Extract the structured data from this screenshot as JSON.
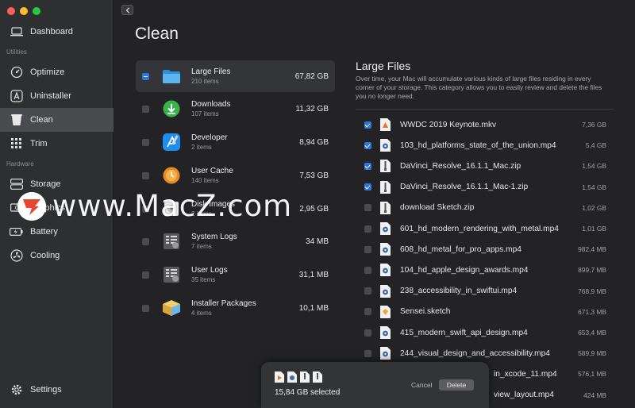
{
  "sidebar": {
    "items": [
      {
        "label": "Dashboard"
      },
      {
        "label": "Optimize"
      },
      {
        "label": "Uninstaller"
      },
      {
        "label": "Clean"
      },
      {
        "label": "Trim"
      },
      {
        "label": "Storage"
      },
      {
        "label": "Graphics"
      },
      {
        "label": "Battery"
      },
      {
        "label": "Cooling"
      },
      {
        "label": "Settings"
      }
    ],
    "sections": {
      "utilities": "Utilities",
      "hardware": "Hardware"
    }
  },
  "main": {
    "title": "Clean",
    "categories": [
      {
        "name": "Large Files",
        "count": "210 items",
        "size": "67,82 GB"
      },
      {
        "name": "Downloads",
        "count": "107 items",
        "size": "11,32 GB"
      },
      {
        "name": "Developer",
        "count": "2 items",
        "size": "8,94 GB"
      },
      {
        "name": "User Cache",
        "count": "140 items",
        "size": "7,53 GB"
      },
      {
        "name": "Disk Images",
        "count": "2 items",
        "size": "2,95 GB"
      },
      {
        "name": "System Logs",
        "count": "7 items",
        "size": "34 MB"
      },
      {
        "name": "User Logs",
        "count": "35 items",
        "size": "31,1 MB"
      },
      {
        "name": "Installer Packages",
        "count": "4 items",
        "size": "10,1 MB"
      }
    ]
  },
  "panel": {
    "title": "Large Files",
    "description": "Over time, your Mac will accumulate various kinds of large files residing in every corner of your storage. This category allows you to easily review and delete the files you no longer need.",
    "files": [
      {
        "name": "WWDC 2019 Keynote.mkv",
        "size": "7,36 GB"
      },
      {
        "name": "103_hd_platforms_state_of_the_union.mp4",
        "size": "5,4 GB"
      },
      {
        "name": "DaVinci_Resolve_16.1.1_Mac.zip",
        "size": "1,54 GB"
      },
      {
        "name": "DaVinci_Resolve_16.1.1_Mac-1.zip",
        "size": "1,54 GB"
      },
      {
        "name": "download Sketch.zip",
        "size": "1,02 GB"
      },
      {
        "name": "601_hd_modern_rendering_with_metal.mp4",
        "size": "1,01 GB"
      },
      {
        "name": "608_hd_metal_for_pro_apps.mp4",
        "size": "982,4 MB"
      },
      {
        "name": "104_hd_apple_design_awards.mp4",
        "size": "899,7 MB"
      },
      {
        "name": "238_accessibility_in_swiftui.mp4",
        "size": "768,9 MB"
      },
      {
        "name": "Sensei.sketch",
        "size": "671,3 MB"
      },
      {
        "name": "415_modern_swift_api_design.mp4",
        "size": "653,4 MB"
      },
      {
        "name": "244_visual_design_and_accessibility.mp4",
        "size": "589,9 MB"
      },
      {
        "name": "in_xcode_11.mp4",
        "size": "576,1 MB"
      },
      {
        "name": "view_layout.mp4",
        "size": "424 MB"
      }
    ]
  },
  "selection": {
    "summary": "15,84 GB selected",
    "cancel_label": "Cancel",
    "delete_label": "Delete"
  },
  "watermark": {
    "text": "www.MacZ.com",
    "logo_letter": "Z"
  },
  "colors": {
    "accent": "#2f74d9",
    "sidebar_active": "#4a4b4e",
    "background": "#232325"
  }
}
